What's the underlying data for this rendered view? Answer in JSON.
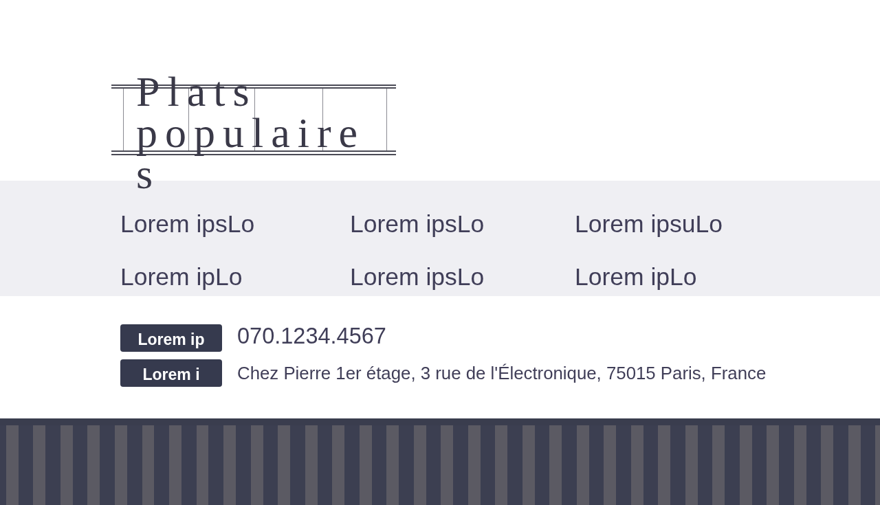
{
  "heading": "Plats populaires",
  "dishes": [
    "Lorem ipsLo",
    "Lorem ipsLo",
    "Lorem ipsuLo",
    "Lorem ipLo",
    "Lorem ipsLo",
    "Lorem ipLo"
  ],
  "contact": [
    {
      "kind": "phone",
      "label": "Lorem ip",
      "value": "070.1234.4567"
    },
    {
      "kind": "address",
      "label": "Lorem i",
      "value": "Chez Pierre 1er étage, 3 rue de l'Électronique, 75015 Paris, France"
    }
  ]
}
